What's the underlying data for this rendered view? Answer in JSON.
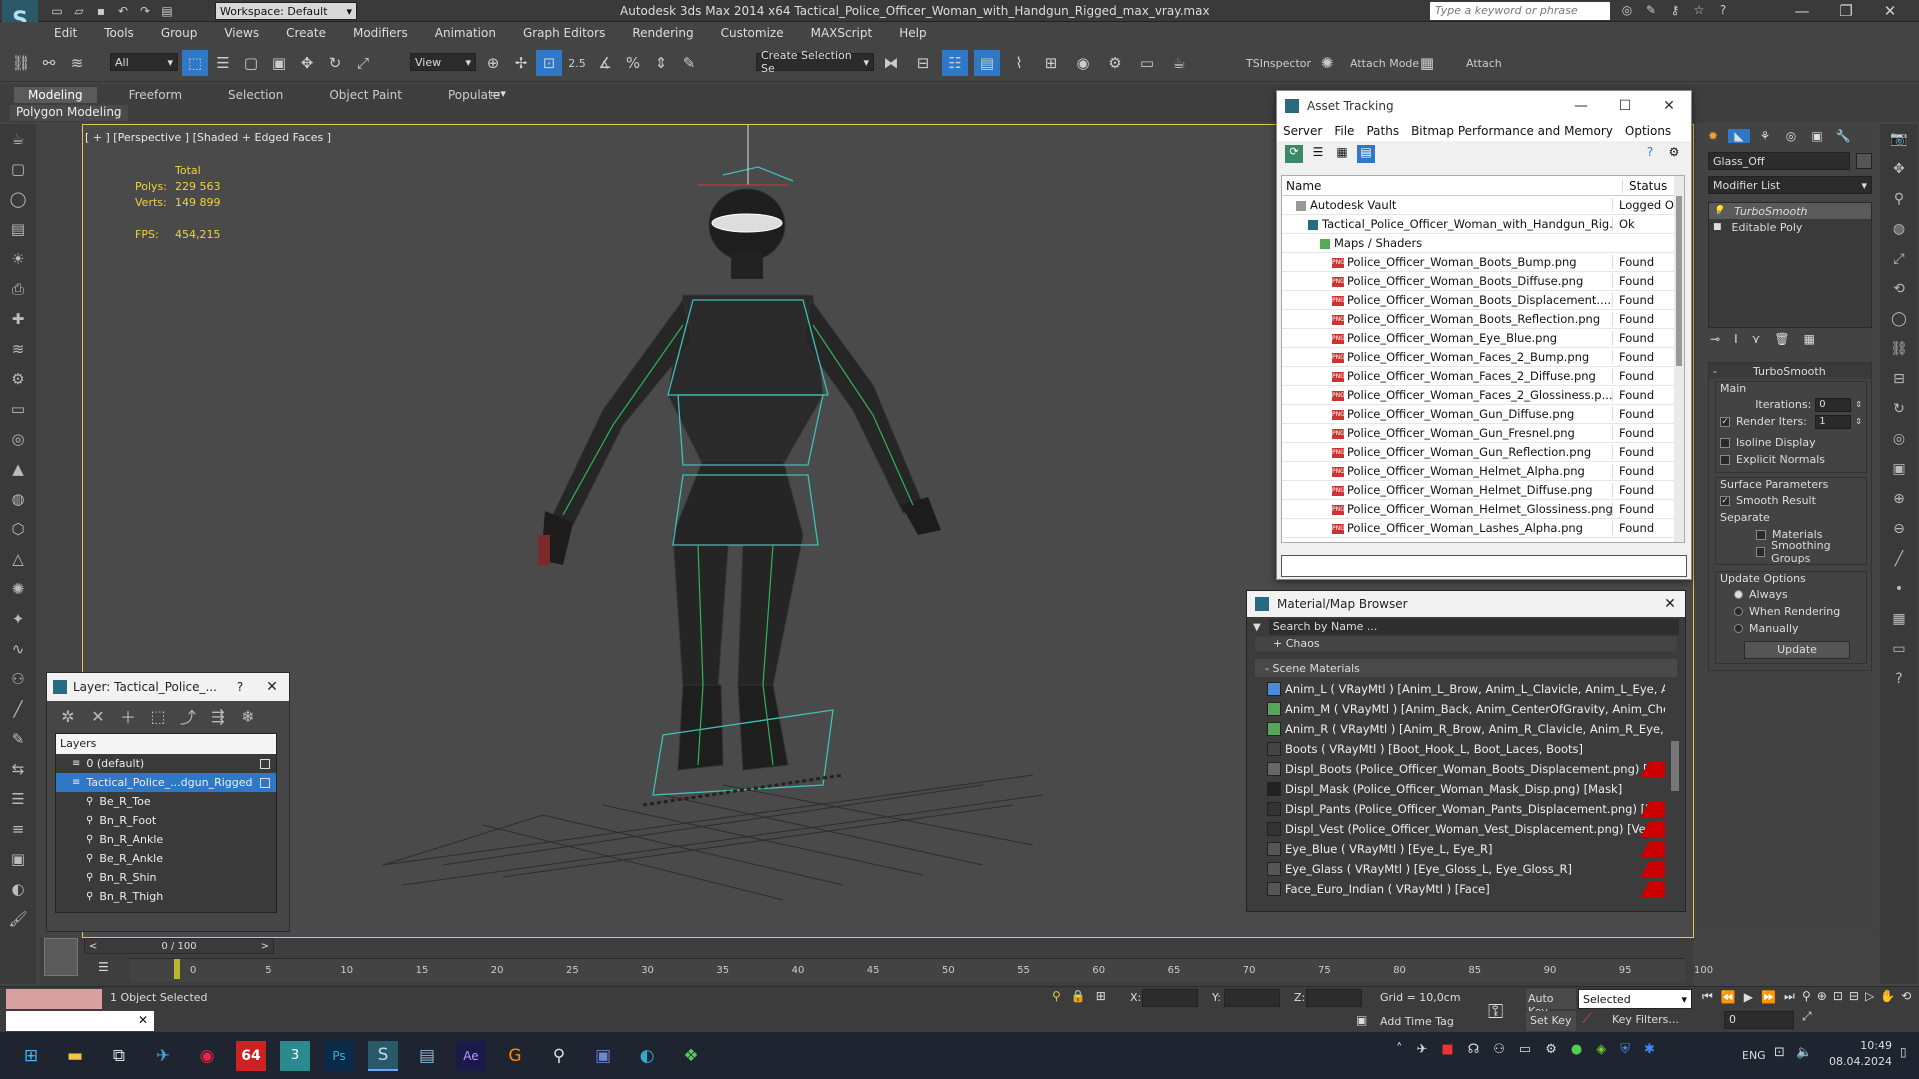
{
  "titlebar": {
    "workspace": "Workspace: Default",
    "title": "Autodesk 3ds Max  2014 x64     Tactical_Police_Officer_Woman_with_Handgun_Rigged_max_vray.max",
    "search_placeholder": "Type a keyword or phrase"
  },
  "menu": [
    "Edit",
    "Tools",
    "Group",
    "Views",
    "Create",
    "Modifiers",
    "Animation",
    "Graph Editors",
    "Rendering",
    "Customize",
    "MAXScript",
    "Help"
  ],
  "toolbar": {
    "filter": "All",
    "refcoord": "View",
    "snap_val": "2.5",
    "named_sel": "Create Selection Se",
    "tsinspector": "TSInspector",
    "attach_mode": "Attach Mode",
    "attach": "Attach"
  },
  "ribbon": {
    "tabs": [
      "Modeling",
      "Freeform",
      "Selection",
      "Object Paint",
      "Populate"
    ],
    "sub": "Polygon Modeling"
  },
  "viewport": {
    "label": "[ + ] [Perspective ] [Shaded + Edged Faces ]",
    "stats_total": "Total",
    "polys_label": "Polys:",
    "polys": "229 563",
    "verts_label": "Verts:",
    "verts": "149 899",
    "fps_label": "FPS:",
    "fps": "454,215"
  },
  "asset": {
    "title": "Asset Tracking",
    "menu": [
      "Server",
      "File",
      "Paths",
      "Bitmap Performance and Memory",
      "Options"
    ],
    "col_name": "Name",
    "col_status": "Status",
    "rows": [
      {
        "name": "Autodesk Vault",
        "status": "Logged O",
        "indent": 1
      },
      {
        "name": "Tactical_Police_Officer_Woman_with_Handgun_Rig...",
        "status": "Ok",
        "indent": 2
      },
      {
        "name": "Maps / Shaders",
        "status": "",
        "indent": 3
      },
      {
        "name": "Police_Officer_Woman_Boots_Bump.png",
        "status": "Found",
        "indent": 4
      },
      {
        "name": "Police_Officer_Woman_Boots_Diffuse.png",
        "status": "Found",
        "indent": 4
      },
      {
        "name": "Police_Officer_Woman_Boots_Displacement....",
        "status": "Found",
        "indent": 4
      },
      {
        "name": "Police_Officer_Woman_Boots_Reflection.png",
        "status": "Found",
        "indent": 4
      },
      {
        "name": "Police_Officer_Woman_Eye_Blue.png",
        "status": "Found",
        "indent": 4
      },
      {
        "name": "Police_Officer_Woman_Faces_2_Bump.png",
        "status": "Found",
        "indent": 4
      },
      {
        "name": "Police_Officer_Woman_Faces_2_Diffuse.png",
        "status": "Found",
        "indent": 4
      },
      {
        "name": "Police_Officer_Woman_Faces_2_Glossiness.p...",
        "status": "Found",
        "indent": 4
      },
      {
        "name": "Police_Officer_Woman_Gun_Diffuse.png",
        "status": "Found",
        "indent": 4
      },
      {
        "name": "Police_Officer_Woman_Gun_Fresnel.png",
        "status": "Found",
        "indent": 4
      },
      {
        "name": "Police_Officer_Woman_Gun_Reflection.png",
        "status": "Found",
        "indent": 4
      },
      {
        "name": "Police_Officer_Woman_Helmet_Alpha.png",
        "status": "Found",
        "indent": 4
      },
      {
        "name": "Police_Officer_Woman_Helmet_Diffuse.png",
        "status": "Found",
        "indent": 4
      },
      {
        "name": "Police_Officer_Woman_Helmet_Glossiness.png",
        "status": "Found",
        "indent": 4
      },
      {
        "name": "Police_Officer_Woman_Lashes_Alpha.png",
        "status": "Found",
        "indent": 4
      }
    ]
  },
  "matbrowser": {
    "title": "Material/Map Browser",
    "search_placeholder": "Search by Name ...",
    "chaos": "+ Chaos",
    "scene": "- Scene Materials",
    "rows": [
      {
        "text": "Anim_L  ( VRayMtl )  [Anim_L_Brow, Anim_L_Clavicle, Anim_L_Eye, Anim...",
        "color": "#4a8ad8",
        "red": false
      },
      {
        "text": "Anim_M  ( VRayMtl )  [Anim_Back, Anim_CenterOfGravity, Anim_Chest, A...",
        "color": "#5aa45a",
        "red": false
      },
      {
        "text": "Anim_R  ( VRayMtl )  [Anim_R_Brow, Anim_R_Clavicle, Anim_R_Eye, Ani...",
        "color": "#5aa45a",
        "red": false
      },
      {
        "text": "Boots  ( VRayMtl )  [Boot_Hook_L, Boot_Laces, Boots]",
        "color": "#444",
        "red": false
      },
      {
        "text": "Displ_Boots (Police_Officer_Woman_Boots_Displacement.png) [Boots]",
        "color": "#666",
        "red": true
      },
      {
        "text": "Displ_Mask (Police_Officer_Woman_Mask_Disp.png) [Mask]",
        "color": "#222",
        "red": false
      },
      {
        "text": "Displ_Pants (Police_Officer_Woman_Pants_Displacement.png) [Holster, P...",
        "color": "#333",
        "red": true
      },
      {
        "text": "Displ_Vest (Police_Officer_Woman_Vest_Displacement.png) [Vest, Vest_...",
        "color": "#333",
        "red": true
      },
      {
        "text": "Eye_Blue  ( VRayMtl )  [Eye_L, Eye_R]",
        "color": "#555",
        "red": true
      },
      {
        "text": "Eye_Glass  ( VRayMtl )  [Eye_Gloss_L, Eye_Gloss_R]",
        "color": "#555",
        "red": true
      },
      {
        "text": "Face_Euro_Indian  ( VRayMtl )  [Face]",
        "color": "#555",
        "red": true
      }
    ]
  },
  "layer": {
    "title": "Layer: Tactical_Police_...",
    "header": "Layers",
    "rows": [
      {
        "name": "0 (default)",
        "sel": false,
        "indent": 1
      },
      {
        "name": "Tactical_Police_...dgun_Rigged",
        "sel": true,
        "indent": 1
      },
      {
        "name": "Be_R_Toe",
        "sel": false,
        "indent": 2
      },
      {
        "name": "Bn_R_Foot",
        "sel": false,
        "indent": 2
      },
      {
        "name": "Bn_R_Ankle",
        "sel": false,
        "indent": 2
      },
      {
        "name": "Be_R_Ankle",
        "sel": false,
        "indent": 2
      },
      {
        "name": "Bn_R_Shin",
        "sel": false,
        "indent": 2
      },
      {
        "name": "Bn_R_Thigh",
        "sel": false,
        "indent": 2
      }
    ]
  },
  "cmdpanel": {
    "object_name": "Glass_Off",
    "modifier_list": "Modifier List",
    "stack": [
      "TurboSmooth",
      "Editable Poly"
    ],
    "rollout": "TurboSmooth",
    "main": "Main",
    "iterations_label": "Iterations:",
    "iterations": "0",
    "render_iters_label": "Render Iters:",
    "render_iters": "1",
    "isoline": "Isoline Display",
    "explicit": "Explicit Normals",
    "surface": "Surface Parameters",
    "smooth_result": "Smooth Result",
    "separate": "Separate",
    "materials": "Materials",
    "smoothing": "Smoothing Groups",
    "update_opts": "Update Options",
    "always": "Always",
    "when_rendering": "When Rendering",
    "manually": "Manually",
    "update": "Update"
  },
  "timeline": {
    "frame": "0 / 100",
    "ticks": [
      "0",
      "5",
      "10",
      "15",
      "20",
      "25",
      "30",
      "35",
      "40",
      "45",
      "50",
      "55",
      "60",
      "65",
      "70",
      "75",
      "80",
      "85",
      "90",
      "95",
      "100"
    ]
  },
  "status": {
    "selected": "1 Object Selected",
    "x": "X:",
    "y": "Y:",
    "z": "Z:",
    "grid": "Grid = 10,0cm",
    "autokey": "Auto Key",
    "autokey_sel": "Selected",
    "setkey": "Set Key",
    "keyfilters": "Key Filters...",
    "addtimetag": "Add Time Tag",
    "frame_val": "0"
  },
  "taskbar": {
    "badge_num": "64",
    "lang": "ENG",
    "time": "10:49",
    "date": "08.04.2024"
  }
}
